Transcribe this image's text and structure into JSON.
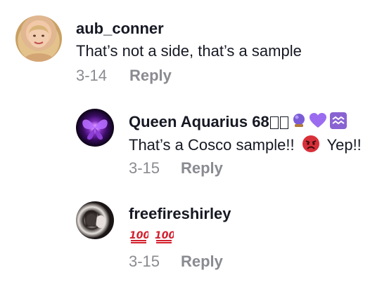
{
  "comments": [
    {
      "username": "aub_conner",
      "text": "That’s not a side, that’s a sample",
      "date": "3-14",
      "reply_label": "Reply"
    },
    {
      "username": "Queen Aquarius 68",
      "username_icons": [
        "unknown-glyph-icon",
        "unknown-glyph-icon",
        "crystal-ball-icon",
        "purple-heart-icon",
        "aquarius-icon"
      ],
      "text_part1": "That’s a Cosco sample!!",
      "text_part2": "Yep!!",
      "text_icon": "angry-face-icon",
      "date": "3-15",
      "reply_label": "Reply"
    },
    {
      "username": "freefireshirley",
      "text_icons": [
        "hundred-points-icon",
        "hundred-points-icon"
      ],
      "date": "3-15",
      "reply_label": "Reply"
    }
  ],
  "colors": {
    "username": "#161823",
    "text": "#161823",
    "meta": "#8a8b91",
    "purple_heart": "#9b6cf0",
    "aquarius_bg": "#8a63d2",
    "angry_face": "#d8303a",
    "hundred": "#d31f2d"
  }
}
